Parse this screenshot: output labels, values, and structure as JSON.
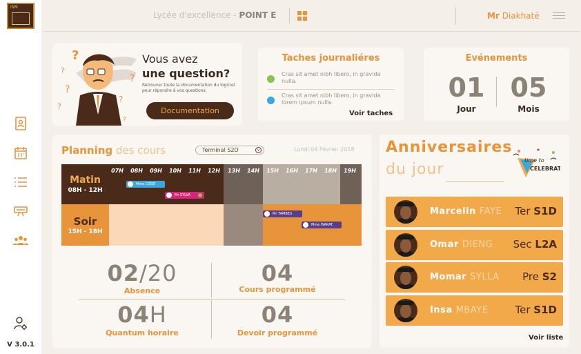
{
  "app": {
    "logo_text": "ISM",
    "version": "V 3.0.1"
  },
  "header": {
    "school_light": "Lycée d'excellence - ",
    "school_bold": "POINT E",
    "user_prefix": "Mr",
    "user_name": "Diakhaté"
  },
  "sidebar": {
    "items": [
      {
        "icon": "student-card-icon"
      },
      {
        "icon": "calendar-icon"
      },
      {
        "icon": "list-icon"
      },
      {
        "icon": "diploma-icon"
      },
      {
        "icon": "group-icon"
      }
    ],
    "settings_icon": "user-settings-icon"
  },
  "question_card": {
    "title_line1": "Vous avez",
    "title_line2": "une question?",
    "text": "Retrouver toute la documentation du logiciel pour répondre à vos questions.",
    "button": "Documentation"
  },
  "tasks_card": {
    "title": "Taches journaliéres",
    "tasks": [
      {
        "text": "Cras sit amet nibh libero, in gravida nulla.",
        "color": "#8bc34a"
      },
      {
        "text": "Cras sit amet nibh libero, in gravida lorem ipsum nulla.",
        "color": "#3aa7e0"
      }
    ],
    "link": "Voir taches"
  },
  "events_card": {
    "title": "Evénements",
    "day_value": "01",
    "day_label": "Jour",
    "month_value": "05",
    "month_label": "Mois"
  },
  "planning": {
    "title_bold": "Planning",
    "title_light": "des cours",
    "class_select": "Terminal S2D",
    "date": "Lundi 04 Février 2018",
    "hours": [
      "07H",
      "08H",
      "09H",
      "10H",
      "11H",
      "12H",
      "13H",
      "14H",
      "15H",
      "16H",
      "17H",
      "18H",
      "19H"
    ],
    "rows": [
      {
        "name": "Matin",
        "range": "08H - 12H"
      },
      {
        "name": "Soir",
        "range": "15H - 18H"
      }
    ],
    "events": [
      {
        "label": "Mme CISSE",
        "avatar": "MC",
        "color": "#3aa7e0"
      },
      {
        "label": "Mr SYLVA",
        "avatar": "MS",
        "color": "#d6267a"
      },
      {
        "label": "Mr TAMBES",
        "avatar": "MT",
        "color": "#5a3d8a"
      },
      {
        "label": "Mme WAKAT.",
        "avatar": "MW",
        "color": "#5a3d8a"
      }
    ]
  },
  "stats": [
    {
      "value": "02",
      "suffix": "/20",
      "label": "Absence"
    },
    {
      "value": "04",
      "suffix": "",
      "label": "Cours programmé"
    },
    {
      "value": "04",
      "suffix": "H",
      "label": "Quantum horaire"
    },
    {
      "value": "04",
      "suffix": "",
      "label": "Devoir programmé"
    }
  ],
  "birthdays": {
    "title1": "Anniversaires",
    "title2": "du jour",
    "badge_line1": "time to",
    "badge_line2": "CELEBRATE!",
    "people": [
      {
        "first": "Marcelin",
        "last": "FAYE",
        "level": "Ter",
        "class": "S1D"
      },
      {
        "first": "Omar",
        "last": "DIENG",
        "level": "Sec",
        "class": "L2A"
      },
      {
        "first": "Momar",
        "last": "SYLLA",
        "level": "Pre",
        "class": "S2"
      },
      {
        "first": "Insa",
        "last": "MBAYE",
        "level": "Ter",
        "class": "S1D"
      }
    ],
    "link": "Voir liste"
  }
}
